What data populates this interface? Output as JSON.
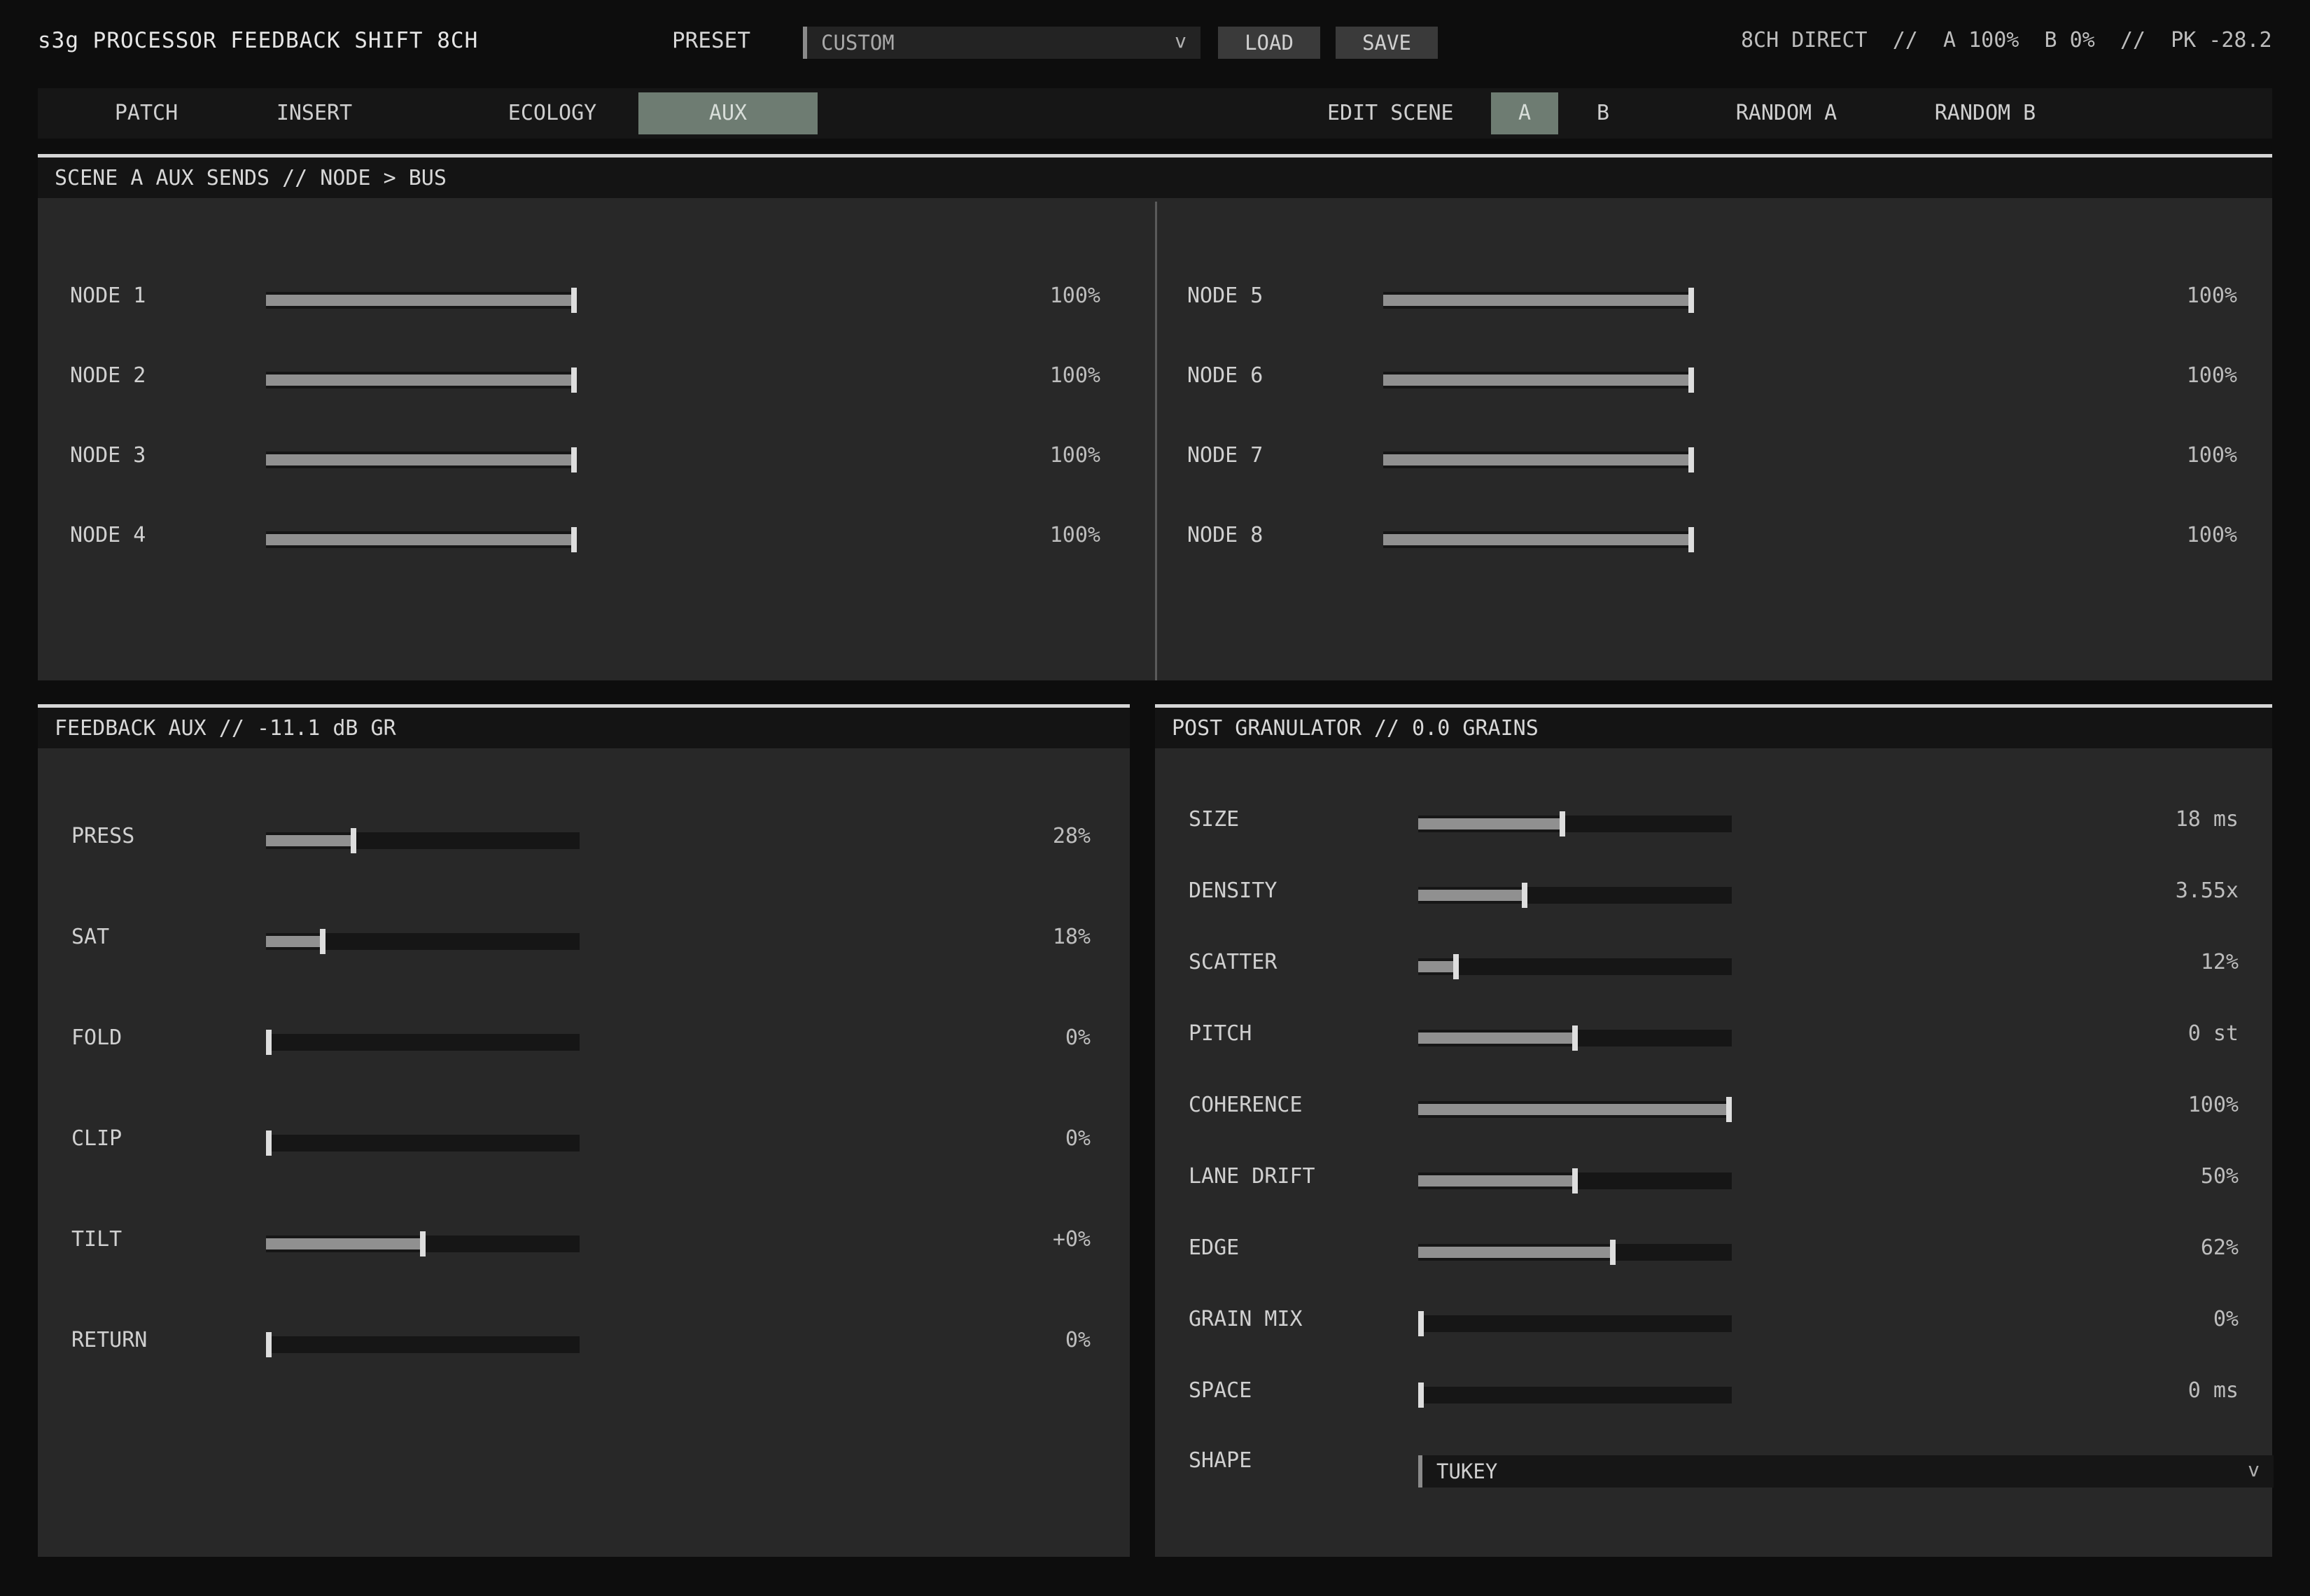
{
  "header": {
    "title": "s3g PROCESSOR FEEDBACK SHIFT 8CH",
    "preset_label": "PRESET",
    "preset_value": "CUSTOM",
    "preset_chevron": "v",
    "load_label": "LOAD",
    "save_label": "SAVE",
    "status": "8CH DIRECT  //  A 100%  B 0%  //  PK -28.2"
  },
  "tabs": {
    "items": [
      {
        "label": "PATCH",
        "active": false
      },
      {
        "label": "INSERT",
        "active": false
      },
      {
        "label": "ECOLOGY",
        "active": false
      },
      {
        "label": "AUX",
        "active": true
      }
    ],
    "edit_scene_label": "EDIT SCENE",
    "scenes": [
      {
        "label": "A",
        "active": true
      },
      {
        "label": "B",
        "active": false
      },
      {
        "label": "RANDOM A",
        "active": false
      },
      {
        "label": "RANDOM B",
        "active": false
      }
    ]
  },
  "aux_sends": {
    "title": "SCENE A AUX SENDS // NODE > BUS",
    "nodes": [
      {
        "label": "NODE 1",
        "value": 1.0,
        "display": "100%"
      },
      {
        "label": "NODE 2",
        "value": 1.0,
        "display": "100%"
      },
      {
        "label": "NODE 3",
        "value": 1.0,
        "display": "100%"
      },
      {
        "label": "NODE 4",
        "value": 1.0,
        "display": "100%"
      },
      {
        "label": "NODE 5",
        "value": 1.0,
        "display": "100%"
      },
      {
        "label": "NODE 6",
        "value": 1.0,
        "display": "100%"
      },
      {
        "label": "NODE 7",
        "value": 1.0,
        "display": "100%"
      },
      {
        "label": "NODE 8",
        "value": 1.0,
        "display": "100%"
      }
    ]
  },
  "feedback_aux": {
    "title": "FEEDBACK AUX // -11.1 dB GR",
    "params": [
      {
        "label": "PRESS",
        "value": 0.28,
        "display": "28%"
      },
      {
        "label": "SAT",
        "value": 0.18,
        "display": "18%"
      },
      {
        "label": "FOLD",
        "value": 0.0,
        "display": "0%"
      },
      {
        "label": "CLIP",
        "value": 0.0,
        "display": "0%"
      },
      {
        "label": "TILT",
        "value": 0.5,
        "display": "+0%"
      },
      {
        "label": "RETURN",
        "value": 0.0,
        "display": "0%"
      }
    ]
  },
  "post_granulator": {
    "title": "POST GRANULATOR // 0.0 GRAINS",
    "params": [
      {
        "label": "SIZE",
        "value": 0.46,
        "display": "18 ms"
      },
      {
        "label": "DENSITY",
        "value": 0.34,
        "display": "3.55x"
      },
      {
        "label": "SCATTER",
        "value": 0.12,
        "display": "12%"
      },
      {
        "label": "PITCH",
        "value": 0.5,
        "display": "0 st"
      },
      {
        "label": "COHERENCE",
        "value": 1.0,
        "display": "100%"
      },
      {
        "label": "LANE DRIFT",
        "value": 0.5,
        "display": "50%"
      },
      {
        "label": "EDGE",
        "value": 0.62,
        "display": "62%"
      },
      {
        "label": "GRAIN MIX",
        "value": 0.0,
        "display": "0%"
      },
      {
        "label": "SPACE",
        "value": 0.0,
        "display": "0 ms"
      }
    ],
    "shape_label": "SHAPE",
    "shape_value": "TUKEY",
    "shape_chevron": "v"
  },
  "colors": {
    "background": "#0d0d0d",
    "panel": "#282828",
    "active_tab": "#6e7c72",
    "fill": "#909090",
    "thumb": "#dedede"
  }
}
